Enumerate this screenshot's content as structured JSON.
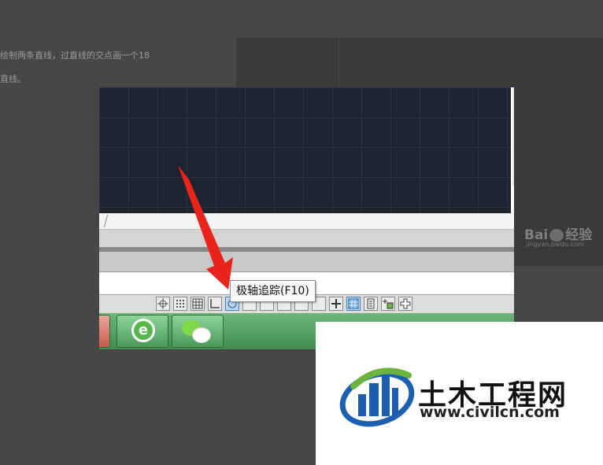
{
  "article": {
    "line1": "绘制两条直线，过直线的交点画一个18",
    "line2": "直线。"
  },
  "baidu": {
    "logo_text": "Bai",
    "logo_suffix": "经验",
    "domain": "jingyan.baidu.com"
  },
  "statusbar": {
    "tooltip": "极轴追踪(F10)"
  },
  "taskbar": {
    "ie_glyph": "e"
  },
  "watermark": {
    "title": "土木工程网",
    "url": "www.civilcn.com"
  },
  "colors": {
    "arrow": "#e8241d",
    "cad_background": "#1e2330",
    "taskbar": "#4f9d5e",
    "logo_blue": "#1c5fb0",
    "logo_green": "#6cb33f"
  }
}
